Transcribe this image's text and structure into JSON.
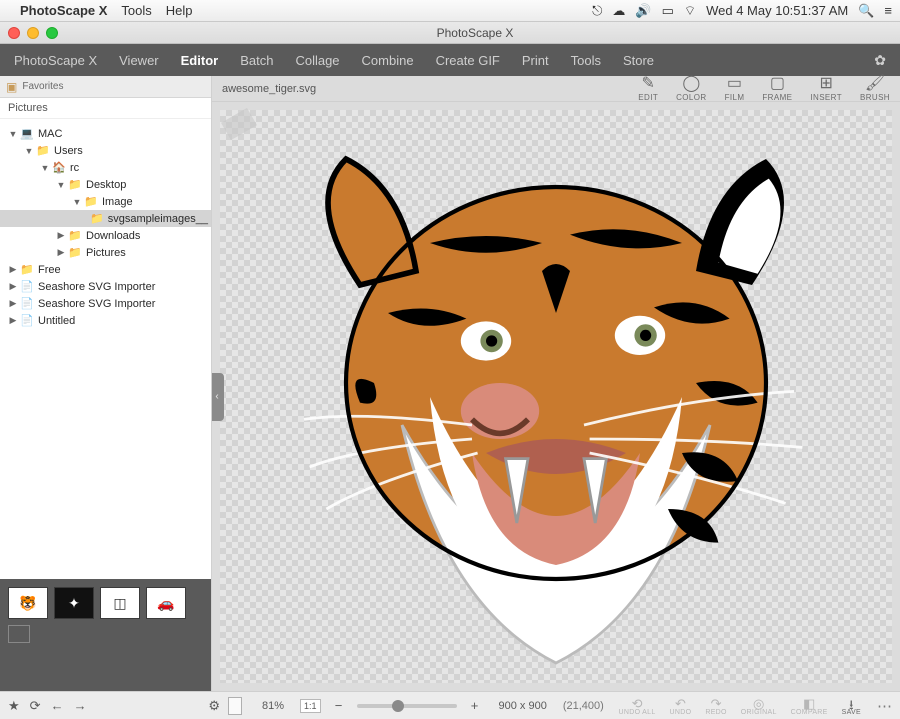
{
  "mac_menu": {
    "app": "PhotoScape X",
    "items": [
      "Tools",
      "Help"
    ],
    "datetime": "Wed 4 May  10:51:37 AM"
  },
  "window": {
    "title": "PhotoScape X"
  },
  "tabs": {
    "items": [
      "PhotoScape X",
      "Viewer",
      "Editor",
      "Batch",
      "Collage",
      "Combine",
      "Create GIF",
      "Print",
      "Tools",
      "Store"
    ],
    "active_index": 2
  },
  "sidebar": {
    "favorites_label": "Favorites",
    "pictures_label": "Pictures",
    "tree": [
      {
        "indent": 0,
        "arrow": "▼",
        "icon": "💻",
        "label": "MAC"
      },
      {
        "indent": 1,
        "arrow": "▼",
        "icon": "📁",
        "label": "Users"
      },
      {
        "indent": 2,
        "arrow": "▼",
        "icon": "🏠",
        "label": "rc"
      },
      {
        "indent": 3,
        "arrow": "▼",
        "icon": "📁",
        "label": "Desktop"
      },
      {
        "indent": 4,
        "arrow": "▼",
        "icon": "📁",
        "label": "Image"
      },
      {
        "indent": 5,
        "arrow": "",
        "icon": "📁",
        "label": "svgsampleimages__",
        "sel": true
      },
      {
        "indent": 3,
        "arrow": "▶",
        "icon": "📁",
        "label": "Downloads"
      },
      {
        "indent": 3,
        "arrow": "▶",
        "icon": "📁",
        "label": "Pictures"
      },
      {
        "indent": 0,
        "arrow": "▶",
        "icon": "📁",
        "label": "Free"
      },
      {
        "indent": 0,
        "arrow": "▶",
        "icon": "📄",
        "label": "Seashore SVG Importer"
      },
      {
        "indent": 0,
        "arrow": "▶",
        "icon": "📄",
        "label": "Seashore SVG Importer"
      },
      {
        "indent": 0,
        "arrow": "▶",
        "icon": "📄",
        "label": "Untitled"
      }
    ]
  },
  "canvas": {
    "filename": "awesome_tiger.svg",
    "tools": [
      {
        "key": "edit",
        "icon": "✎",
        "label": "EDIT"
      },
      {
        "key": "color",
        "icon": "◯",
        "label": "COLOR"
      },
      {
        "key": "film",
        "icon": "▭",
        "label": "FILM"
      },
      {
        "key": "frame",
        "icon": "▢",
        "label": "FRAME"
      },
      {
        "key": "insert",
        "icon": "⊞",
        "label": "INSERT"
      },
      {
        "key": "brush",
        "icon": "🖌",
        "label": "BRUSH"
      }
    ]
  },
  "bottom": {
    "zoom_pct": "81%",
    "zoom_11": "1:1",
    "dims": "900 x 900",
    "coords": "(21,400)",
    "actions": [
      {
        "key": "undoall",
        "icon": "⟲",
        "label": "UNDO ALL",
        "enabled": false
      },
      {
        "key": "undo",
        "icon": "↶",
        "label": "UNDO",
        "enabled": false
      },
      {
        "key": "redo",
        "icon": "↷",
        "label": "REDO",
        "enabled": false
      },
      {
        "key": "original",
        "icon": "◎",
        "label": "ORIGINAL",
        "enabled": false
      },
      {
        "key": "compare",
        "icon": "◧",
        "label": "COMPARE",
        "enabled": false
      },
      {
        "key": "save",
        "icon": "⭳",
        "label": "SAVE",
        "enabled": true
      }
    ]
  }
}
